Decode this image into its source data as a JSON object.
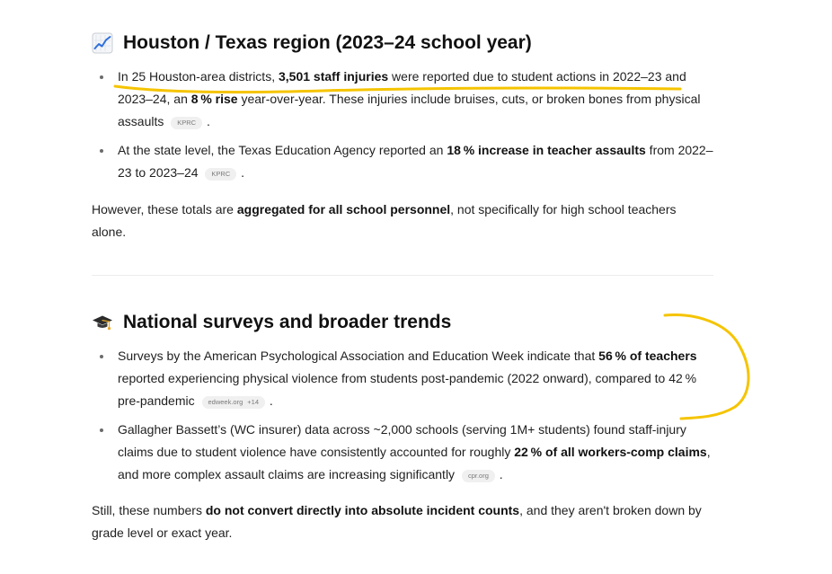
{
  "section1": {
    "icon": "chart-increasing-icon",
    "title": "Houston / Texas region (2023–24 school year)",
    "bullet1": {
      "t1": "In 25 Houston-area districts, ",
      "b1": "3,501 staff injuries",
      "t2": " were reported due to student actions in 2022–23 and 2023–24, an ",
      "b2": "8 % rise",
      "t3": " year-over-year. These injuries include bruises, cuts, or broken bones from physical assaults",
      "cite": "KPRC",
      "end": "."
    },
    "bullet2": {
      "t1": "At the state level, the Texas Education Agency reported an ",
      "b1": "18 % increase in teacher assaults",
      "t2": " from 2022–23 to 2023–24",
      "cite": "KPRC",
      "end": "."
    },
    "note": {
      "t1": "However, these totals are ",
      "b1": "aggregated for all school personnel",
      "t2": ", not specifically for high school teachers alone."
    }
  },
  "section2": {
    "icon": "graduation-cap-icon",
    "title": "National surveys and broader trends",
    "bullet1": {
      "t1": "Surveys by the American Psychological Association and Education Week indicate that ",
      "b1": "56 % of teachers",
      "t2": " reported experiencing physical violence from students post-pandemic (2022 onward), compared to 42 % pre-pandemic",
      "cite": "edweek.org",
      "cite_extra": "+14",
      "end": "."
    },
    "bullet2": {
      "t1": "Gallagher Bassett’s (WC insurer) data across ~2,000 schools (serving 1M+ students) found staff-injury claims due to student violence have consistently accounted for roughly ",
      "b1": "22 % of all workers-comp claims",
      "t2": ", and more complex assault claims are increasing significantly",
      "cite": "cpr.org",
      "end": "."
    },
    "note": {
      "t1": "Still, these numbers ",
      "b1": "do not convert directly into absolute incident counts",
      "t2": ", and they aren't broken down by grade level or exact year."
    }
  },
  "colors": {
    "annotation": "#f5c400",
    "text": "#1f1f1f",
    "citation_bg": "#f0f0f0"
  }
}
